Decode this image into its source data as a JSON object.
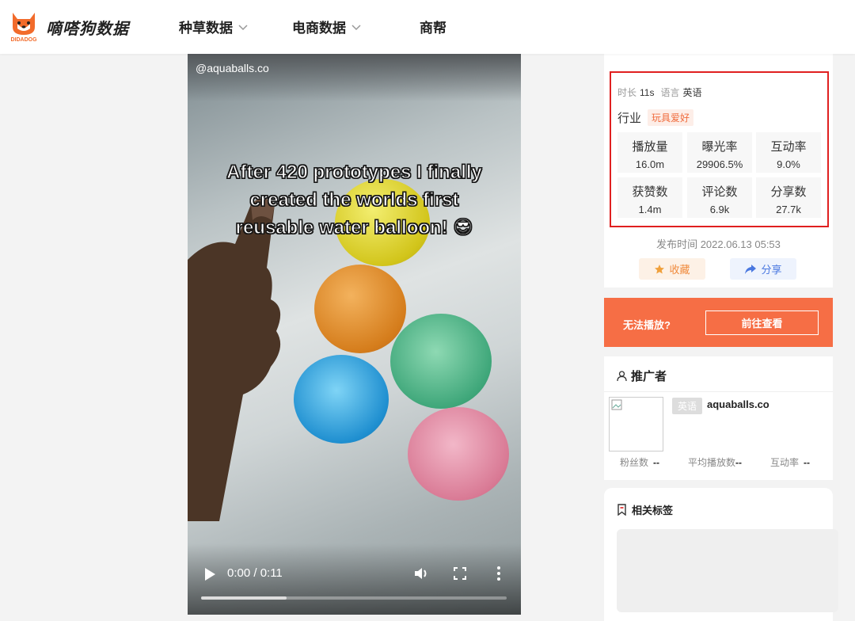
{
  "header": {
    "brand": "嘀嗒狗数据",
    "logo_text": "DIDADOG",
    "nav": [
      {
        "label": "种草数据",
        "has_dropdown": true
      },
      {
        "label": "电商数据",
        "has_dropdown": true
      },
      {
        "label": "商帮",
        "has_dropdown": false
      }
    ]
  },
  "video": {
    "handle": "@aquaballs.co",
    "caption_lines": [
      "After 420 prototypes I finally",
      "created the worlds first",
      "reusable water balloon! 😎"
    ],
    "time": "0:00 / 0:11",
    "progress_fraction": 0.28
  },
  "info": {
    "duration_label": "时长",
    "duration": "11s",
    "language_label": "语言",
    "language": "英语",
    "industry_label": "行业",
    "industry_tag": "玩具爱好",
    "stats": [
      {
        "label": "播放量",
        "value": "16.0m"
      },
      {
        "label": "曝光率",
        "value": "29906.5%"
      },
      {
        "label": "互动率",
        "value": "9.0%"
      },
      {
        "label": "获赞数",
        "value": "1.4m"
      },
      {
        "label": "评论数",
        "value": "6.9k"
      },
      {
        "label": "分享数",
        "value": "27.7k"
      }
    ],
    "publish": "发布时间 2022.06.13 05:53",
    "fav_label": "收藏",
    "share_label": "分享"
  },
  "banner": {
    "text": "无法播放?",
    "button": "前往查看"
  },
  "promoter": {
    "title": "推广者",
    "lang_tag": "英语",
    "name": "aquaballs.co",
    "fans_label": "粉丝数",
    "fans_value": "--",
    "avg_label": "平均播放数",
    "avg_value": "--",
    "rate_label": "互动率",
    "rate_value": "--"
  },
  "tags": {
    "title": "相关标签"
  },
  "colors": {
    "highlight_border": "#e02020",
    "banner": "#f66e45",
    "industry_tag": "#f06b3c"
  }
}
